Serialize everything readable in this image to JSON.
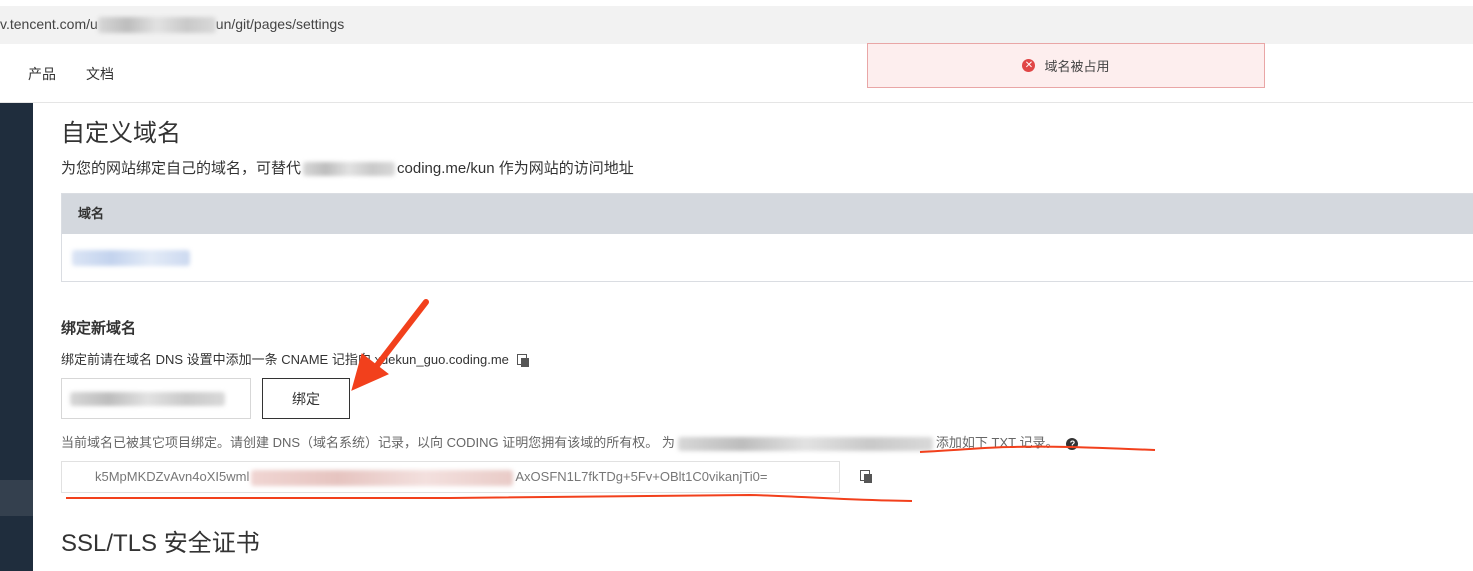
{
  "browser": {
    "url_prefix": "v.tencent.com/u",
    "url_suffix": "un/git/pages/settings"
  },
  "topnav": {
    "items": [
      {
        "label": "产品"
      },
      {
        "label": "文档"
      }
    ]
  },
  "toast": {
    "message": "域名被占用",
    "icon": "error-circle-icon",
    "colors": {
      "background": "#fdeeee",
      "border": "#e9a6a6",
      "icon": "#e04646"
    }
  },
  "custom_domain": {
    "title": "自定义域名",
    "description_prefix": "为您的网站绑定自己的域名，可替代",
    "description_suffix": "coding.me/kun 作为网站的访问地址",
    "table": {
      "column_header": "域名"
    }
  },
  "bind_new": {
    "title": "绑定新域名",
    "note_part1": "绑定前请在域名 DNS 设置中添加一条 CNAME 记",
    "note_part2": "指向 xuekun_guo.coding.me",
    "button_label": "绑定",
    "warning_prefix": "当前域名已被其它项目绑定。请创建 DNS（域名系统）记录，以向 CODING 证明您拥有该域的所有权。 为",
    "warning_suffix": "添加如下 TXT 记录。",
    "txt_record_start": "k5MpMKDZvAvn4oXI5wml",
    "txt_record_end": "AxOSFN1L7fkTDg+5Fv+OBlt1C0vikanjTi0="
  },
  "ssl": {
    "title": "SSL/TLS 安全证书"
  },
  "annotation_color": "#f2401c"
}
